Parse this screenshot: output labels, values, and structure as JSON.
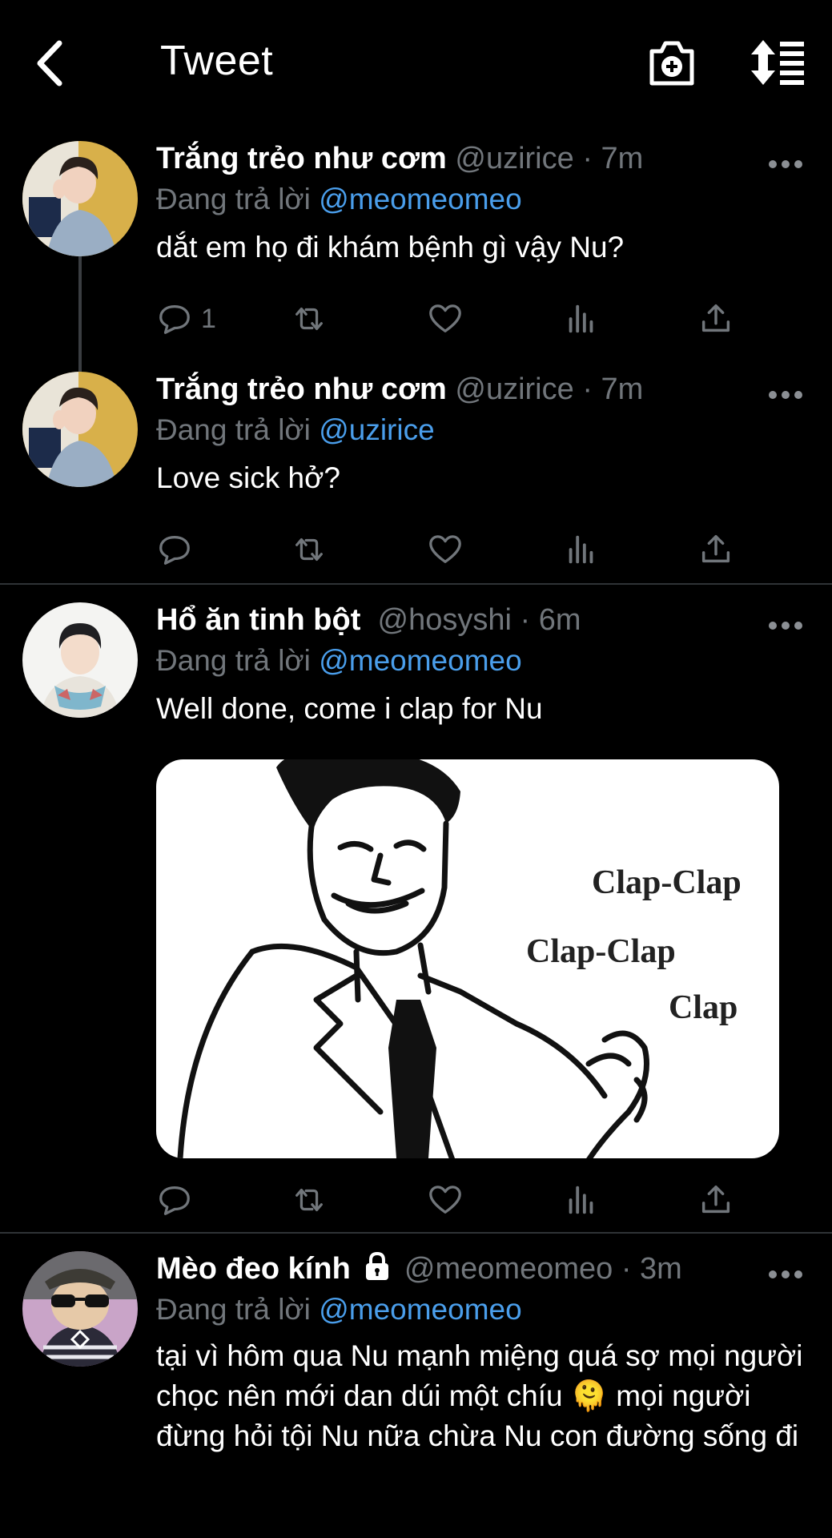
{
  "header": {
    "title": "Tweet",
    "back_icon": "chevron-left-icon",
    "camera_icon": "camera-plus-icon",
    "sort_icon": "sort-list-icon"
  },
  "tweets": [
    {
      "name": "Trắng trẻo như cơm",
      "handle": "@uzirice · 7m",
      "replying_prefix": "Đang trả lời",
      "replying_to": "@meomeomeo",
      "text": "dắt em họ đi khám bệnh gì vậy Nu?",
      "reply_count": "1"
    },
    {
      "name": "Trắng trẻo như cơm",
      "handle": "@uzirice · 7m",
      "replying_prefix": "Đang trả lời",
      "replying_to": "@uzirice",
      "text": "Love sick hở?",
      "reply_count": ""
    },
    {
      "name": "Hổ ăn tinh bột",
      "handle": "@hosyshi · 6m",
      "replying_prefix": "Đang trả lời",
      "replying_to": "@meomeomeo",
      "text": "Well done, come i clap for Nu",
      "reply_count": "",
      "media_text": [
        "Clap-Clap",
        "Clap-Clap",
        "Clap"
      ]
    },
    {
      "name": "Mèo đeo kính",
      "handle": "@meomeomeo · 3m",
      "replying_prefix": "Đang trả lời",
      "replying_to": "@meomeomeo",
      "text": "tại vì hôm qua Nu mạnh miệng quá sợ mọi người chọc nên mới dan dúi một chíu 🫠 mọi người đừng hỏi tội Nu nữa chừa Nu con đường sống đi",
      "locked": true
    }
  ],
  "colors": {
    "background": "#000000",
    "link": "#4a9eeb",
    "muted": "#71767b"
  }
}
